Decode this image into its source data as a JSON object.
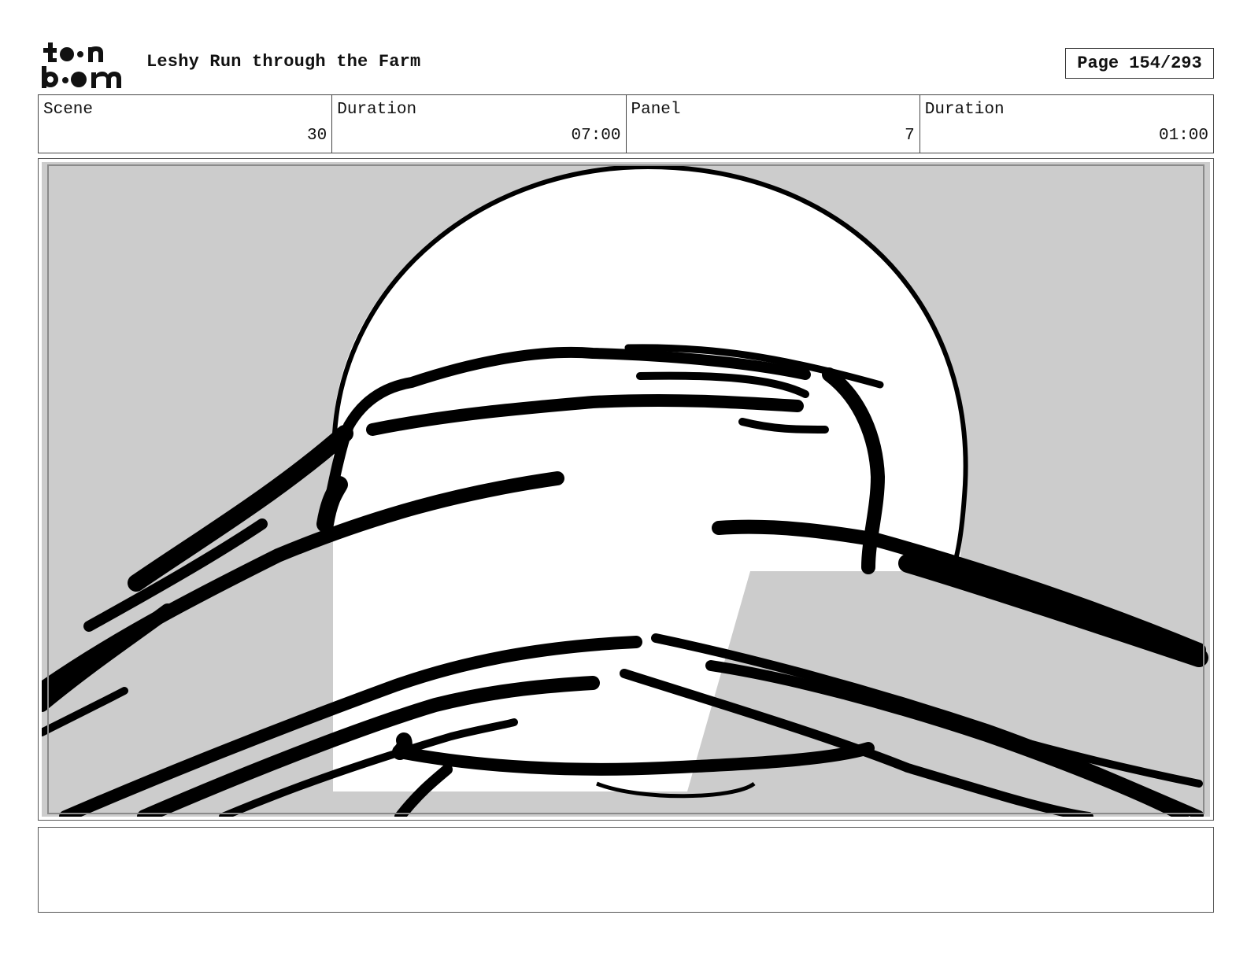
{
  "header": {
    "logo_text_top": "toon",
    "logo_text_bottom": "boom",
    "title": "Leshy Run through the Farm",
    "page_label": "Page 154/293"
  },
  "info": {
    "scene_label": "Scene",
    "scene_value": "30",
    "scene_duration_label": "Duration",
    "scene_duration_value": "07:00",
    "panel_label": "Panel",
    "panel_value": "7",
    "panel_duration_label": "Duration",
    "panel_duration_value": "01:00"
  },
  "panel": {
    "background_color": "#cccccc",
    "moon_color": "#ffffff",
    "ink_color": "#000000"
  },
  "notes": {
    "text": ""
  }
}
